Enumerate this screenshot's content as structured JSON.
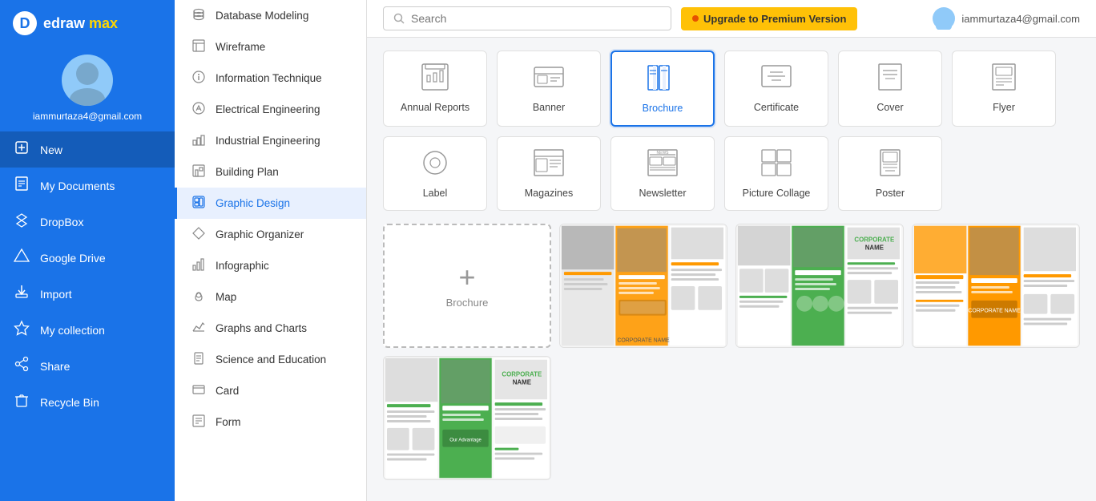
{
  "app": {
    "name": "edraw",
    "name_highlight": "max",
    "logo_letter": "D"
  },
  "user": {
    "email": "iammurtaza4@gmail.com",
    "avatar_icon": "👤"
  },
  "topbar": {
    "search_placeholder": "Search",
    "upgrade_label": "Upgrade to Premium Version"
  },
  "sidebar_nav": [
    {
      "id": "new",
      "label": "New",
      "icon": "➕",
      "active": true
    },
    {
      "id": "my-documents",
      "label": "My Documents",
      "icon": "📄",
      "active": false
    },
    {
      "id": "dropbox",
      "label": "DropBox",
      "icon": "📦",
      "active": false
    },
    {
      "id": "google-drive",
      "label": "Google Drive",
      "icon": "△",
      "active": false
    },
    {
      "id": "import",
      "label": "Import",
      "icon": "📥",
      "active": false
    },
    {
      "id": "my-collection",
      "label": "My collection",
      "icon": "⭐",
      "active": false
    },
    {
      "id": "share",
      "label": "Share",
      "icon": "↗",
      "active": false
    },
    {
      "id": "recycle-bin",
      "label": "Recycle Bin",
      "icon": "🗑",
      "active": false
    }
  ],
  "middle_menu": [
    {
      "id": "database-modeling",
      "label": "Database Modeling",
      "icon": "db",
      "active": false
    },
    {
      "id": "wireframe",
      "label": "Wireframe",
      "icon": "wf",
      "active": false
    },
    {
      "id": "information-technique",
      "label": "Information Technique",
      "icon": "it",
      "active": false
    },
    {
      "id": "electrical-engineering",
      "label": "Electrical Engineering",
      "icon": "ee",
      "active": false
    },
    {
      "id": "industrial-engineering",
      "label": "Industrial Engineering",
      "icon": "ie",
      "active": false
    },
    {
      "id": "building-plan",
      "label": "Building Plan",
      "icon": "bp",
      "active": false
    },
    {
      "id": "graphic-design",
      "label": "Graphic Design",
      "icon": "gd",
      "active": true
    },
    {
      "id": "graphic-organizer",
      "label": "Graphic Organizer",
      "icon": "go",
      "active": false
    },
    {
      "id": "infographic",
      "label": "Infographic",
      "icon": "in",
      "active": false
    },
    {
      "id": "map",
      "label": "Map",
      "icon": "mp",
      "active": false
    },
    {
      "id": "graphs-and-charts",
      "label": "Graphs and Charts",
      "icon": "gc",
      "active": false
    },
    {
      "id": "science-and-education",
      "label": "Science and Education",
      "icon": "se",
      "active": false
    },
    {
      "id": "card",
      "label": "Card",
      "icon": "cd",
      "active": false
    },
    {
      "id": "form",
      "label": "Form",
      "icon": "fm",
      "active": false
    }
  ],
  "category_cards": [
    {
      "id": "annual-reports",
      "label": "Annual Reports",
      "selected": false
    },
    {
      "id": "banner",
      "label": "Banner",
      "selected": false
    },
    {
      "id": "brochure",
      "label": "Brochure",
      "selected": true
    },
    {
      "id": "certificate",
      "label": "Certificate",
      "selected": false
    },
    {
      "id": "cover",
      "label": "Cover",
      "selected": false
    },
    {
      "id": "flyer",
      "label": "Flyer",
      "selected": false
    },
    {
      "id": "label",
      "label": "Label",
      "selected": false
    },
    {
      "id": "magazines",
      "label": "Magazines",
      "selected": false
    },
    {
      "id": "newsletter",
      "label": "Newsletter",
      "selected": false
    },
    {
      "id": "picture-collage",
      "label": "Picture Collage",
      "selected": false
    },
    {
      "id": "poster",
      "label": "Poster",
      "selected": false
    }
  ],
  "templates": {
    "new_label": "Brochure",
    "items": [
      {
        "id": "tpl1",
        "style": "orange-corp"
      },
      {
        "id": "tpl2",
        "style": "green-corp"
      },
      {
        "id": "tpl3",
        "style": "orange-corp-2"
      },
      {
        "id": "tpl4",
        "style": "green-corp-2"
      }
    ]
  },
  "colors": {
    "primary": "#1a73e8",
    "accent": "#ffc107",
    "sidebar_bg": "#1a73e8",
    "selected_card_border": "#1a73e8"
  }
}
